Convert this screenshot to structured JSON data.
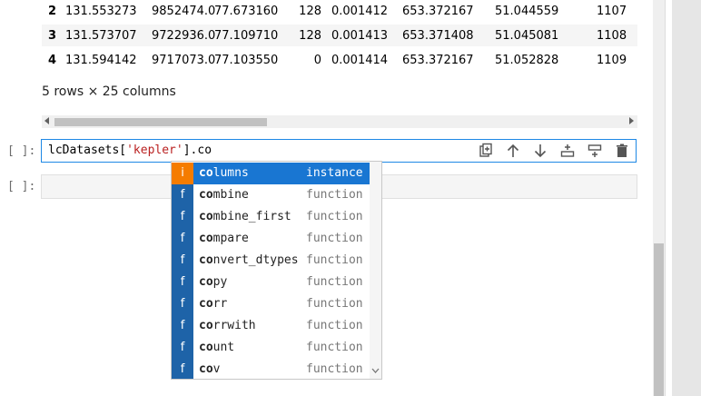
{
  "dataframe": {
    "rows": [
      {
        "index": "2",
        "cells": [
          "131.553273",
          "9852474.0",
          "77.673160",
          "128",
          "0.001412",
          "653.372167",
          "51.044559",
          "1107"
        ]
      },
      {
        "index": "3",
        "cells": [
          "131.573707",
          "9722936.0",
          "77.109710",
          "128",
          "0.001413",
          "653.371408",
          "51.045081",
          "1108"
        ]
      },
      {
        "index": "4",
        "cells": [
          "131.594142",
          "9717073.0",
          "77.103550",
          "0",
          "0.001414",
          "653.372167",
          "51.052828",
          "1109"
        ]
      }
    ],
    "shape_note": "5 rows × 25 columns"
  },
  "cells": {
    "active_prompt": "[ ]:",
    "empty_prompt": "[ ]:",
    "code_prefix": "lcDatasets[",
    "code_string": "'kepler'",
    "code_suffix": "].co"
  },
  "completer": {
    "match": "co",
    "items": [
      {
        "type": "i",
        "name": "columns",
        "rest": "lumns",
        "kind": "instance"
      },
      {
        "type": "f",
        "name": "combine",
        "rest": "mbine",
        "kind": "function"
      },
      {
        "type": "f",
        "name": "combine_first",
        "rest": "mbine_first",
        "kind": "function"
      },
      {
        "type": "f",
        "name": "compare",
        "rest": "mpare",
        "kind": "function"
      },
      {
        "type": "f",
        "name": "convert_dtypes",
        "rest": "nvert_dtypes",
        "kind": "function"
      },
      {
        "type": "f",
        "name": "copy",
        "rest": "py",
        "kind": "function"
      },
      {
        "type": "f",
        "name": "corr",
        "rest": "rr",
        "kind": "function"
      },
      {
        "type": "f",
        "name": "corrwith",
        "rest": "rrwith",
        "kind": "function"
      },
      {
        "type": "f",
        "name": "count",
        "rest": "unt",
        "kind": "function"
      },
      {
        "type": "f",
        "name": "cov",
        "rest": "v",
        "kind": "function"
      }
    ]
  },
  "toolbar": {
    "icons": [
      "duplicate-icon",
      "move-up-icon",
      "move-down-icon",
      "insert-above-icon",
      "insert-below-icon",
      "delete-icon"
    ]
  },
  "colors": {
    "accent": "#1976d2",
    "instance_badge": "#f57c00",
    "function_badge": "#1e63a8",
    "string": "#ba2121"
  }
}
